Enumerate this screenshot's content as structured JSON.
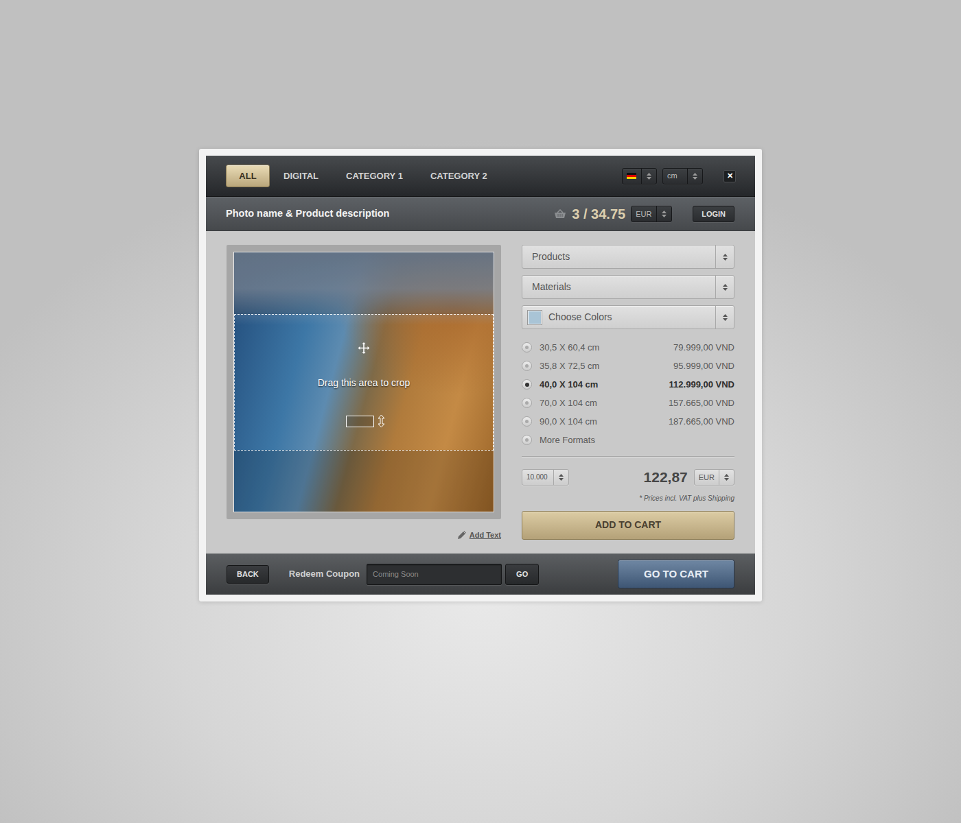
{
  "tabs": [
    {
      "label": "ALL",
      "selected": true
    },
    {
      "label": "DIGITAL",
      "selected": false
    },
    {
      "label": "CATEGORY 1",
      "selected": false
    },
    {
      "label": "CATEGORY 2",
      "selected": false
    }
  ],
  "toolbar": {
    "unit": "cm",
    "close": "✕"
  },
  "product_bar": {
    "title": "Photo name & Product description",
    "cart_summary": "3 / 34.75",
    "currency": "EUR",
    "login": "LOGIN"
  },
  "crop": {
    "hint": "Drag this area to crop"
  },
  "add_text": "Add Text",
  "selects": [
    {
      "label": "Products",
      "kind": "plain"
    },
    {
      "label": "Materials",
      "kind": "plain"
    },
    {
      "label": "Choose Colors",
      "kind": "color",
      "swatch": "#a9c4d6"
    }
  ],
  "formats": [
    {
      "size": "30,5 X 60,4 cm",
      "price": "79.999,00 VND",
      "selected": false
    },
    {
      "size": "35,8 X 72,5 cm",
      "price": "95.999,00 VND",
      "selected": false
    },
    {
      "size": "40,0 X 104 cm",
      "price": "112.999,00 VND",
      "selected": true
    },
    {
      "size": "70,0 X 104 cm",
      "price": "157.665,00 VND",
      "selected": false
    },
    {
      "size": "90,0 X 104 cm",
      "price": "187.665,00 VND",
      "selected": false
    },
    {
      "size": "More Formats",
      "selected": false
    }
  ],
  "order": {
    "quantity": "10.000",
    "total": "122,87",
    "currency": "EUR",
    "note": "* Prices incl. VAT plus Shipping",
    "add_to_cart": "ADD TO CART"
  },
  "footer": {
    "back": "BACK",
    "coupon_label": "Redeem Coupon",
    "coupon_placeholder": "Coming Soon",
    "go": "GO",
    "go_to_cart": "GO TO CART"
  }
}
